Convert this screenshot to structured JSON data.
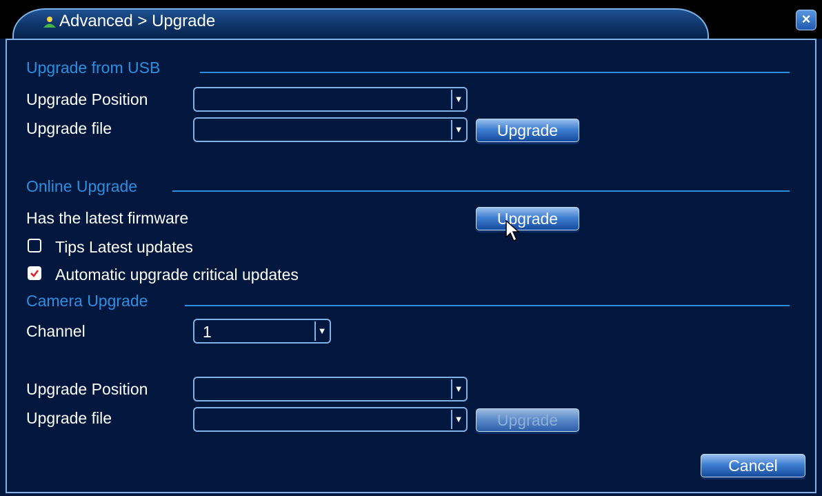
{
  "window": {
    "title": "Advanced > Upgrade",
    "title_icon": "user-icon",
    "close_icon": "close-icon",
    "close_glyph": "×"
  },
  "usb": {
    "section_title": "Upgrade from USB",
    "position_label": "Upgrade Position",
    "position_value": "",
    "file_label": "Upgrade file",
    "file_value": "",
    "upgrade_button": "Upgrade"
  },
  "online": {
    "section_title": "Online Upgrade",
    "status_text": "Has the latest firmware",
    "upgrade_button": "Upgrade",
    "tips_label": "Tips Latest updates",
    "tips_checked": false,
    "auto_label": "Automatic upgrade critical updates",
    "auto_checked": true
  },
  "camera": {
    "section_title": "Camera Upgrade",
    "channel_label": "Channel",
    "channel_value": "1",
    "position_label": "Upgrade Position",
    "position_value": "",
    "file_label": "Upgrade file",
    "file_value": "",
    "upgrade_button": "Upgrade",
    "upgrade_enabled": false
  },
  "footer": {
    "cancel_button": "Cancel"
  },
  "colors": {
    "background": "#01173d",
    "accent_border": "#7fb2e8",
    "section_title": "#2d8fe0",
    "text": "#ffffff"
  }
}
